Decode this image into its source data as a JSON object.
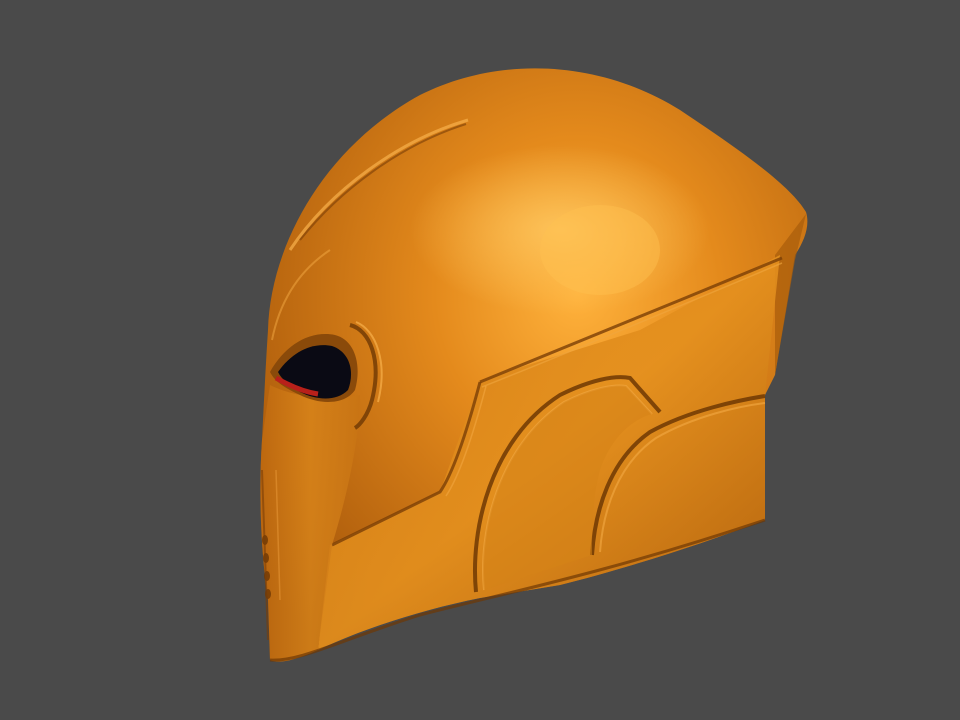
{
  "viewport": {
    "background_color": "#4a4a4a"
  },
  "model": {
    "subject": "helmet",
    "material_color": "#e08a1a",
    "highlight_color": "#ffb040",
    "shadow_color": "#8a4a08",
    "eye_inner_color": "#0a0a14",
    "eye_accent_color": "#b8201a"
  }
}
